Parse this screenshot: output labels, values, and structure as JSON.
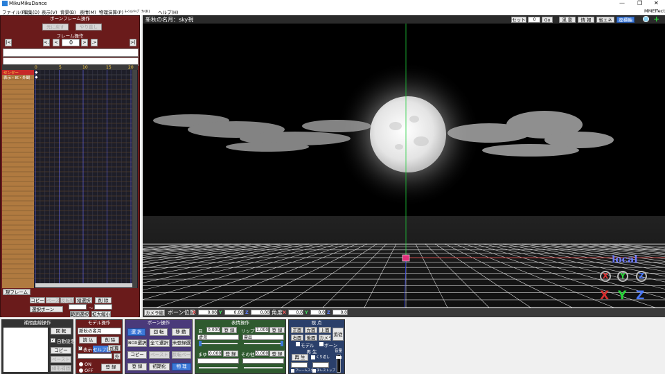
{
  "app": {
    "title": "MikuMikuDance"
  },
  "menu": {
    "items": [
      "ファイル(F)",
      "編集(D)",
      "表示(V)",
      "背景(B)",
      "表情(M)",
      "物理演算(P)",
      "ﾓｰｼｮﾝｷｬﾌﾟ ﾁｬ(K)",
      "ヘルプ(H)"
    ],
    "plugin": "MMEffect"
  },
  "left": {
    "header": "ボーンフレーム操作",
    "undo": "元に戻す",
    "redo": "やり直し",
    "frame_op": "フレーム操作",
    "frame_value": "0",
    "ruler": [
      "0",
      "5",
      "10",
      "15",
      "20"
    ],
    "row0": "センター",
    "row1": "表示・IK・外観",
    "current_frame": "現フレーム",
    "copy": "コピー",
    "paste": "ペースト",
    "reverse": "反転貼",
    "vsel": "縦選択",
    "del": "削 除",
    "sel_bone": "選択ボーン",
    "tilde": "〜",
    "range_sel": "範囲選択",
    "scale": "拡大縮小"
  },
  "viewport": {
    "title": "新秋の名月：sky視",
    "set": "セット",
    "set_value": "0",
    "go": "Go",
    "shadow": "黒 影",
    "info": "情 報",
    "eco": "省エネ",
    "axis": "座標軸",
    "local": "local",
    "x": "X",
    "y": "Y",
    "z": "Z"
  },
  "camera_bar": {
    "tab": "カメラ編",
    "pos_label": "ボーン位置",
    "x": "X",
    "y": "Y",
    "z": "Z",
    "px": "0.00",
    "py": "0.00",
    "pz": "0.00",
    "ang_label": "角度",
    "ax": "0.0",
    "ay": "0.0",
    "az": "0.0"
  },
  "interp": {
    "title": "補間曲線操作",
    "rotate": "回 転",
    "auto": "自動設定",
    "copy": "コピー",
    "paste": "ペースト",
    "linear": "線形補間"
  },
  "model": {
    "title": "モデル操作",
    "model_name": "新秋の名月",
    "load": "読 込",
    "delete": "削 除",
    "show": "表示",
    "shadow": "セルフ影",
    "add": "加算",
    "outside": "外",
    "on": "ON",
    "off": "OFF",
    "register": "登 録"
  },
  "bone": {
    "title": "ボーン操作",
    "select": "選 択",
    "rotate": "回 転",
    "move": "移 動",
    "box": "BOX選択",
    "all": "全て選択",
    "unreg": "未登録選",
    "copy": "コピー",
    "paste": "ペースト",
    "reverse": "反転ペースト",
    "register": "登 録",
    "init": "初期化",
    "physics": "物 理"
  },
  "face": {
    "title": "表情操作",
    "eye": "目",
    "eye_val": "0.000",
    "lip": "リップ",
    "lip_val": "1.000",
    "reg": "登 録",
    "eye_sel": "虚海_",
    "lip_sel": "雲出",
    "brow": "まゆ",
    "brow_val": "0.000",
    "other": "その他",
    "other_val": "0.000"
  },
  "view": {
    "title": "視 点",
    "front": "正面",
    "left": "左面",
    "top": "上面",
    "right": "右面",
    "back": "後面",
    "camera": "カメラ",
    "track": "追従",
    "model": "モデル",
    "bone": "ボーン",
    "play_title": "再 生",
    "play": "再 生",
    "loop": "くり返し",
    "start": "フレームスタート",
    "stop": "フレストップ",
    "vol": "音量"
  },
  "colors": {
    "accent_red": "#6a1b1b",
    "model_panel": "#6a1b1b",
    "bone_panel": "#4a3a7a",
    "face_panel": "#2f5a2f",
    "view_panel": "#2a3f6a",
    "interp_panel": "#333333"
  }
}
